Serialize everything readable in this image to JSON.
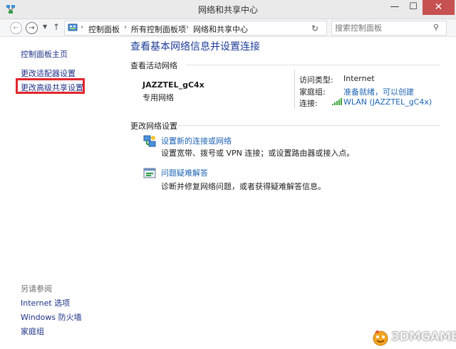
{
  "window": {
    "title": "网络和共享中心",
    "minimize": "—",
    "maximize": "☐",
    "close": "✕"
  },
  "nav": {
    "back_icon": "arrow-left-icon",
    "forward_icon": "arrow-right-icon",
    "history_icon": "chevron-down-icon",
    "up_icon": "arrow-up-icon",
    "breadcrumbs": [
      "控制面板",
      "所有控制面板项",
      "网络和共享中心"
    ],
    "search_placeholder": "搜索控制面板"
  },
  "sidebar": {
    "items": [
      "控制面板主页",
      "更改适配器设置",
      "更改高级共享设置"
    ],
    "highlighted_item": "更改高级共享设置",
    "highlight_color": "#e0252c",
    "see_also_title": "另请参阅",
    "see_also": [
      "Internet 选项",
      "Windows 防火墙",
      "家庭组"
    ]
  },
  "main": {
    "heading": "查看基本网络信息并设置连接",
    "active_networks_title": "查看活动网络",
    "network": {
      "name": "JAZZTEL_gC4x",
      "type": "专用网络",
      "properties": [
        {
          "label": "访问类型:",
          "value": "Internet",
          "is_link": false
        },
        {
          "label": "家庭组:",
          "value": "准备就绪，可以创建",
          "is_link": true
        },
        {
          "label": "连接:",
          "value": "WLAN (JAZZTEL_gC4x)",
          "is_link": true
        }
      ]
    },
    "change_settings_title": "更改网络设置",
    "tasks": [
      {
        "icon": "network-setup-icon",
        "link": "设置新的连接或网络",
        "desc": "设置宽带、拨号或 VPN 连接；或设置路由器或接入点。"
      },
      {
        "icon": "troubleshoot-icon",
        "link": "问题疑难解答",
        "desc": "诊断并修复网络问题，或者获得疑难解答信息。"
      }
    ]
  },
  "watermark": {
    "text": "3DMGAME"
  },
  "colors": {
    "link": "#1e64b4",
    "heading": "#1e3c96",
    "close_button": "#c75050"
  }
}
